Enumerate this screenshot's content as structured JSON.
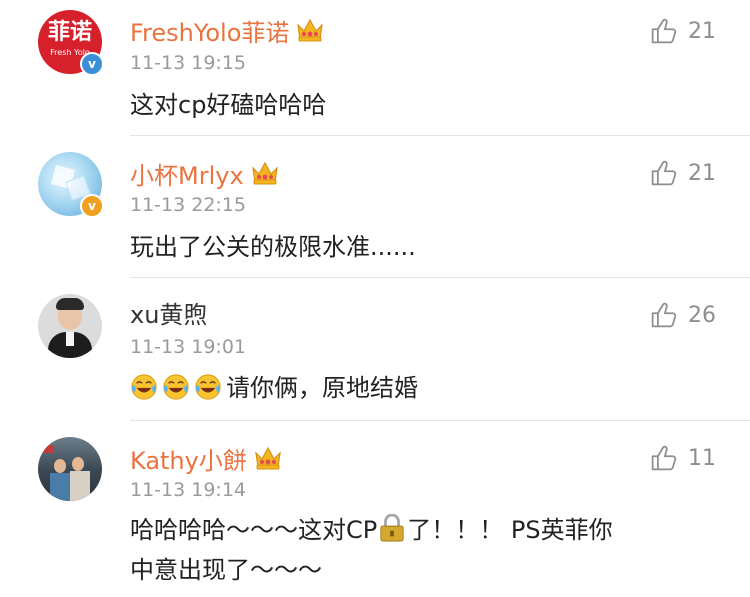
{
  "comments": [
    {
      "username": "FreshYolo菲诺",
      "avatar_text": "菲诺",
      "avatar_subtext": "Fresh Yolo",
      "verify_mark": "v",
      "crown_level": "6",
      "time": "11-13 19:15",
      "text": "这对cp好磕哈哈哈",
      "likes": "21"
    },
    {
      "username": "小杯Mrlyx",
      "verify_mark": "v",
      "crown_level": "5",
      "time": "11-13 22:15",
      "text": "玩出了公关的极限水准......",
      "likes": "21"
    },
    {
      "username": "xu黄煦",
      "time": "11-13 19:01",
      "text": "请你俩，原地结婚",
      "likes": "26"
    },
    {
      "username": "Kathy小餅",
      "time": "11-13 19:14",
      "text_line1_a": "哈哈哈哈～～～这对CP",
      "text_line1_b": "了！！！ PS英菲你",
      "text_line2": "中意出现了～～～",
      "likes": "11"
    }
  ],
  "colors": {
    "vip_name": "#eb7340",
    "verify_blue": "#3a8fd8",
    "verify_gold": "#f0a020",
    "timestamp": "#9a9a9a",
    "like_gray": "#8e8e8e"
  },
  "icons": [
    "thumbs-up-icon",
    "crown-icon",
    "verified-icon",
    "laughing-emoji-icon",
    "lock-icon"
  ]
}
